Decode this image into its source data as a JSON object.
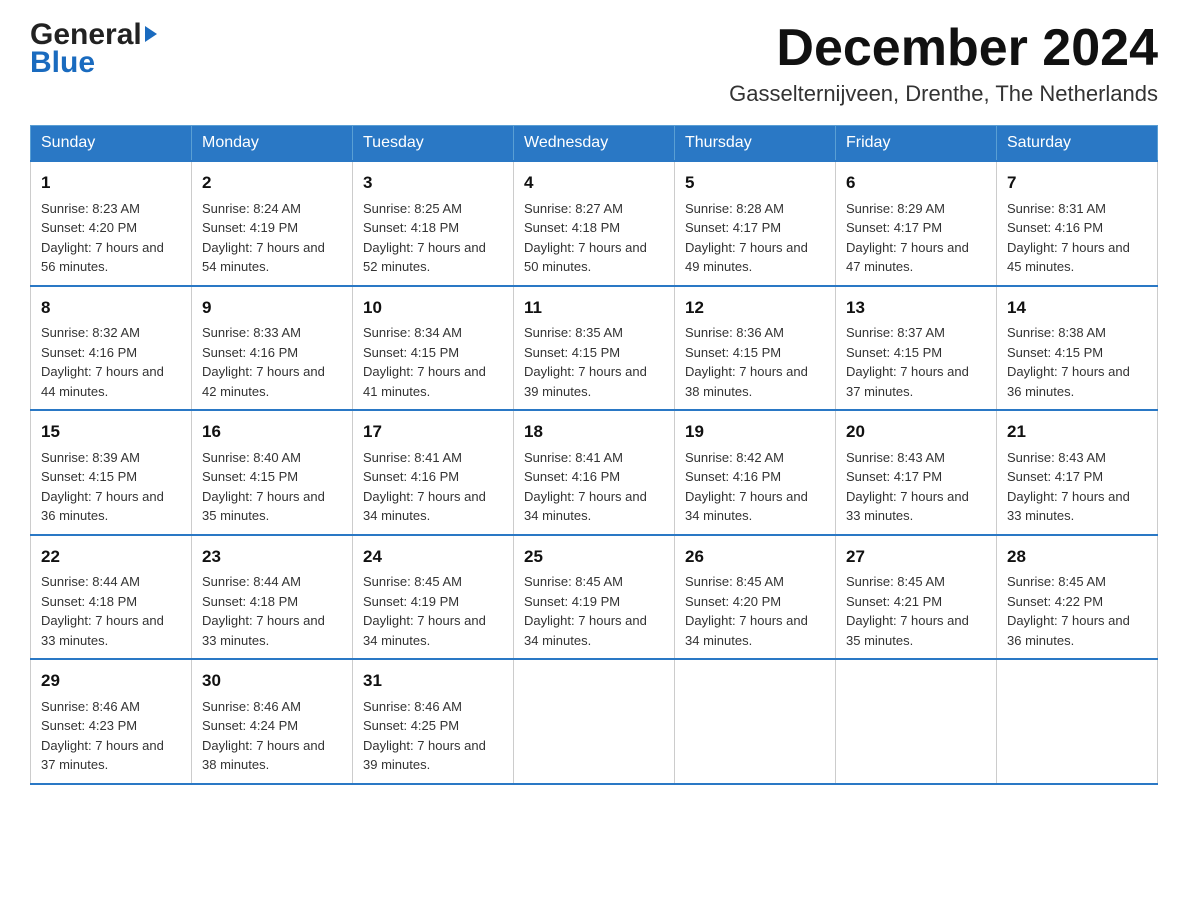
{
  "header": {
    "logo_general": "General",
    "logo_blue": "Blue",
    "month_title": "December 2024",
    "location": "Gasselternijveen, Drenthe, The Netherlands"
  },
  "days_of_week": [
    "Sunday",
    "Monday",
    "Tuesday",
    "Wednesday",
    "Thursday",
    "Friday",
    "Saturday"
  ],
  "weeks": [
    [
      {
        "day": "1",
        "sunrise": "8:23 AM",
        "sunset": "4:20 PM",
        "daylight": "7 hours and 56 minutes."
      },
      {
        "day": "2",
        "sunrise": "8:24 AM",
        "sunset": "4:19 PM",
        "daylight": "7 hours and 54 minutes."
      },
      {
        "day": "3",
        "sunrise": "8:25 AM",
        "sunset": "4:18 PM",
        "daylight": "7 hours and 52 minutes."
      },
      {
        "day": "4",
        "sunrise": "8:27 AM",
        "sunset": "4:18 PM",
        "daylight": "7 hours and 50 minutes."
      },
      {
        "day": "5",
        "sunrise": "8:28 AM",
        "sunset": "4:17 PM",
        "daylight": "7 hours and 49 minutes."
      },
      {
        "day": "6",
        "sunrise": "8:29 AM",
        "sunset": "4:17 PM",
        "daylight": "7 hours and 47 minutes."
      },
      {
        "day": "7",
        "sunrise": "8:31 AM",
        "sunset": "4:16 PM",
        "daylight": "7 hours and 45 minutes."
      }
    ],
    [
      {
        "day": "8",
        "sunrise": "8:32 AM",
        "sunset": "4:16 PM",
        "daylight": "7 hours and 44 minutes."
      },
      {
        "day": "9",
        "sunrise": "8:33 AM",
        "sunset": "4:16 PM",
        "daylight": "7 hours and 42 minutes."
      },
      {
        "day": "10",
        "sunrise": "8:34 AM",
        "sunset": "4:15 PM",
        "daylight": "7 hours and 41 minutes."
      },
      {
        "day": "11",
        "sunrise": "8:35 AM",
        "sunset": "4:15 PM",
        "daylight": "7 hours and 39 minutes."
      },
      {
        "day": "12",
        "sunrise": "8:36 AM",
        "sunset": "4:15 PM",
        "daylight": "7 hours and 38 minutes."
      },
      {
        "day": "13",
        "sunrise": "8:37 AM",
        "sunset": "4:15 PM",
        "daylight": "7 hours and 37 minutes."
      },
      {
        "day": "14",
        "sunrise": "8:38 AM",
        "sunset": "4:15 PM",
        "daylight": "7 hours and 36 minutes."
      }
    ],
    [
      {
        "day": "15",
        "sunrise": "8:39 AM",
        "sunset": "4:15 PM",
        "daylight": "7 hours and 36 minutes."
      },
      {
        "day": "16",
        "sunrise": "8:40 AM",
        "sunset": "4:15 PM",
        "daylight": "7 hours and 35 minutes."
      },
      {
        "day": "17",
        "sunrise": "8:41 AM",
        "sunset": "4:16 PM",
        "daylight": "7 hours and 34 minutes."
      },
      {
        "day": "18",
        "sunrise": "8:41 AM",
        "sunset": "4:16 PM",
        "daylight": "7 hours and 34 minutes."
      },
      {
        "day": "19",
        "sunrise": "8:42 AM",
        "sunset": "4:16 PM",
        "daylight": "7 hours and 34 minutes."
      },
      {
        "day": "20",
        "sunrise": "8:43 AM",
        "sunset": "4:17 PM",
        "daylight": "7 hours and 33 minutes."
      },
      {
        "day": "21",
        "sunrise": "8:43 AM",
        "sunset": "4:17 PM",
        "daylight": "7 hours and 33 minutes."
      }
    ],
    [
      {
        "day": "22",
        "sunrise": "8:44 AM",
        "sunset": "4:18 PM",
        "daylight": "7 hours and 33 minutes."
      },
      {
        "day": "23",
        "sunrise": "8:44 AM",
        "sunset": "4:18 PM",
        "daylight": "7 hours and 33 minutes."
      },
      {
        "day": "24",
        "sunrise": "8:45 AM",
        "sunset": "4:19 PM",
        "daylight": "7 hours and 34 minutes."
      },
      {
        "day": "25",
        "sunrise": "8:45 AM",
        "sunset": "4:19 PM",
        "daylight": "7 hours and 34 minutes."
      },
      {
        "day": "26",
        "sunrise": "8:45 AM",
        "sunset": "4:20 PM",
        "daylight": "7 hours and 34 minutes."
      },
      {
        "day": "27",
        "sunrise": "8:45 AM",
        "sunset": "4:21 PM",
        "daylight": "7 hours and 35 minutes."
      },
      {
        "day": "28",
        "sunrise": "8:45 AM",
        "sunset": "4:22 PM",
        "daylight": "7 hours and 36 minutes."
      }
    ],
    [
      {
        "day": "29",
        "sunrise": "8:46 AM",
        "sunset": "4:23 PM",
        "daylight": "7 hours and 37 minutes."
      },
      {
        "day": "30",
        "sunrise": "8:46 AM",
        "sunset": "4:24 PM",
        "daylight": "7 hours and 38 minutes."
      },
      {
        "day": "31",
        "sunrise": "8:46 AM",
        "sunset": "4:25 PM",
        "daylight": "7 hours and 39 minutes."
      },
      null,
      null,
      null,
      null
    ]
  ]
}
